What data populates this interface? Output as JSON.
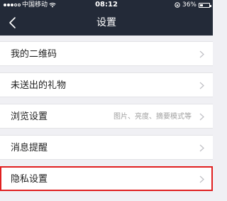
{
  "status_bar": {
    "carrier": "中国移动",
    "time": "08:12",
    "battery_percent": "36%",
    "battery_level": 0.36
  },
  "nav": {
    "title": "设置"
  },
  "settings": [
    {
      "label": "我的二维码",
      "value": ""
    },
    {
      "label": "未送出的礼物",
      "value": ""
    },
    {
      "label": "浏览设置",
      "value": "图片、亮度、摘要模式等"
    },
    {
      "label": "消息提醒",
      "value": ""
    },
    {
      "label": "隐私设置",
      "value": "",
      "highlighted": true
    }
  ],
  "colors": {
    "header_bg": "#232a38",
    "highlight": "#e02020"
  }
}
